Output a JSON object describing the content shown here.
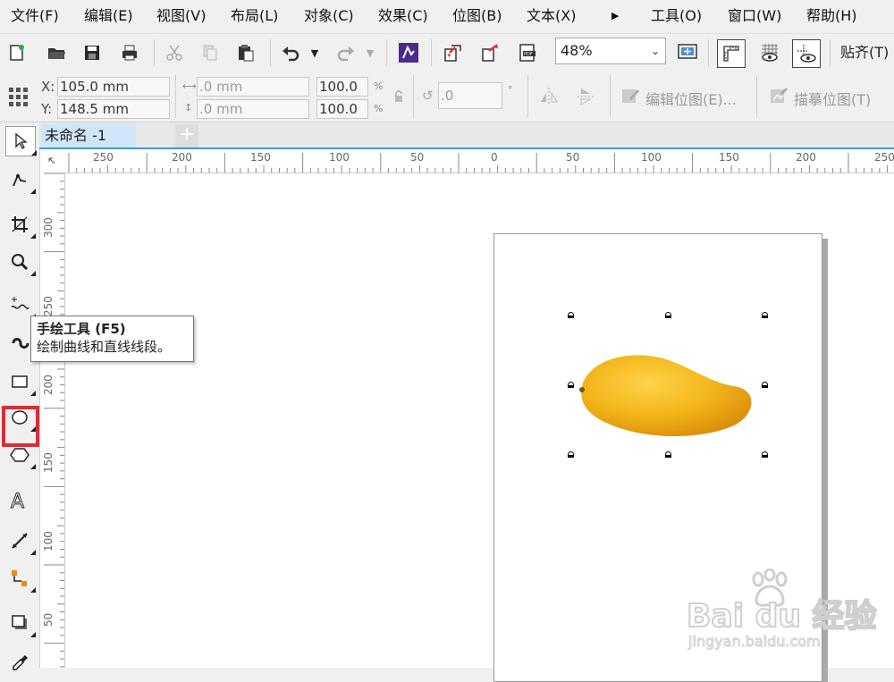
{
  "menu": {
    "items": [
      "文件(F)",
      "编辑(E)",
      "视图(V)",
      "布局(L)",
      "对象(C)",
      "效果(C)",
      "位图(B)",
      "文本(X)",
      "工具(O)",
      "窗口(W)",
      "帮助(H)"
    ],
    "more_icon": "triangle-right-icon"
  },
  "toolbar": {
    "zoom_value": "48%",
    "snap_label": "贴齐(T)"
  },
  "propbar": {
    "x_label": "X:",
    "x_value": "105.0 mm",
    "y_label": "Y:",
    "y_value": "148.5 mm",
    "width_value": ".0 mm",
    "height_value": ".0 mm",
    "scale_w": "100.0",
    "scale_h": "100.0",
    "percent": "%",
    "rotation_value": ".0",
    "degree": "°",
    "edit_bitmap_label": "编辑位图(E)...",
    "trace_bitmap_label": "描摹位图(T)"
  },
  "tabs": {
    "document": "未命名 -1",
    "add": "+"
  },
  "rulers": {
    "horizontal": [
      "250",
      "200",
      "150",
      "100",
      "50",
      "0",
      "50",
      "100",
      "150",
      "200",
      "250"
    ],
    "vertical": [
      "300",
      "250",
      "200",
      "150",
      "100",
      "50"
    ]
  },
  "tooltip": {
    "title": "手绘工具 (F5)",
    "description": "绘制曲线和直线线段。"
  },
  "watermark": {
    "brand": "Bai du 经验",
    "url": "jingyan.baidu.com"
  },
  "colors": {
    "accent": "#3a9ad9",
    "highlight": "#e8262d",
    "mango": "#f2b51a"
  }
}
